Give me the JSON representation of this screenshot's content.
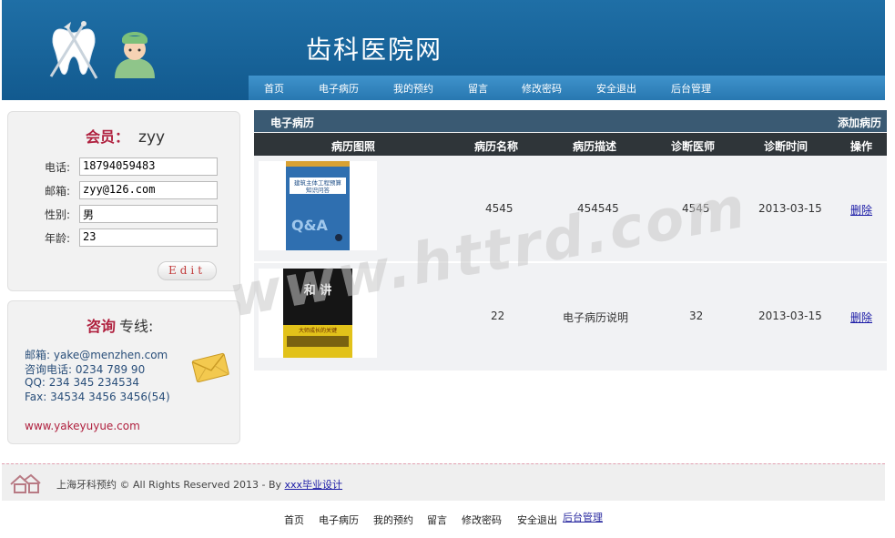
{
  "header": {
    "site_title": "齿科医院网",
    "nav": [
      "首页",
      "电子病历",
      "我的预约",
      "留言",
      "修改密码",
      "安全退出",
      "后台管理"
    ]
  },
  "member": {
    "heading_label": "会员：",
    "username": "zyy",
    "fields": [
      {
        "label": "电话:",
        "value": "18794059483"
      },
      {
        "label": "邮箱:",
        "value": "zyy@126.com"
      },
      {
        "label": "性别:",
        "value": "男"
      },
      {
        "label": "年龄:",
        "value": "23"
      }
    ],
    "edit_label": "Edit"
  },
  "consult": {
    "heading_label": "咨询",
    "heading_suffix": "专线:",
    "lines": [
      "邮箱: yake@menzhen.com",
      "咨询电话: 0234 789 90",
      "QQ: 234 345 234534",
      "Fax: 34534 3456 3456(54)"
    ],
    "website": "www.yakeyuyue.com"
  },
  "main": {
    "title": "电子病历",
    "add_label": "添加病历",
    "columns": [
      "病历图照",
      "病历名称",
      "病历描述",
      "诊断医师",
      "诊断时间",
      "操作"
    ],
    "rows": [
      {
        "name": "4545",
        "description": "454545",
        "doctor": "4545",
        "date": "2013-03-15",
        "action": "删除",
        "cover_text": "建筑主体工程预算知识问答"
      },
      {
        "name": "22",
        "description": "电子病历说明",
        "doctor": "32",
        "date": "2013-03-15",
        "action": "删除",
        "cover_text": "大师成长的关键"
      }
    ]
  },
  "watermark": "www.httrd.com",
  "footer": {
    "copyright_text": "上海牙科预约 © All Rights Reserved 2013 - By ",
    "copyright_link": "xxx毕业设计",
    "nav": [
      "首页",
      "电子病历",
      "我的预约",
      "留言",
      "修改密码",
      "安全退出",
      "后台管理"
    ]
  },
  "colors": {
    "header_blue": "#1a659d",
    "nav_blue": "#3386c0",
    "accent_red": "#b0213f",
    "table_title": "#3a5a73",
    "table_header": "#2f3539"
  }
}
